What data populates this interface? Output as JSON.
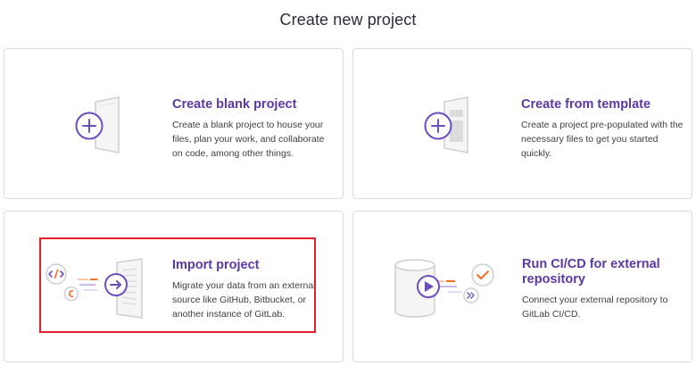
{
  "page_title": "Create new project",
  "cards": {
    "blank": {
      "title": "Create blank project",
      "description": "Create a blank project to house your files, plan your work, and collaborate on code, among other things.",
      "icon": "plus-document-icon"
    },
    "template": {
      "title": "Create from template",
      "description": "Create a project pre-populated with the necessary files to get you started quickly.",
      "icon": "plus-template-icon"
    },
    "import": {
      "title": "Import project",
      "description": "Migrate your data from an external source like GitHub, Bitbucket, or another instance of GitLab.",
      "icon": "import-arrow-icon"
    },
    "cicd": {
      "title": "Run CI/CD for external repository",
      "description": "Connect your external repository to GitLab CI/CD.",
      "icon": "play-pipeline-icon"
    }
  },
  "colors": {
    "accent": "#5a3aa0",
    "illus_purple": "#6b4fbb",
    "illus_orange": "#fc6d26",
    "card_border": "#dbdbdb",
    "highlight": "#e2202a"
  }
}
